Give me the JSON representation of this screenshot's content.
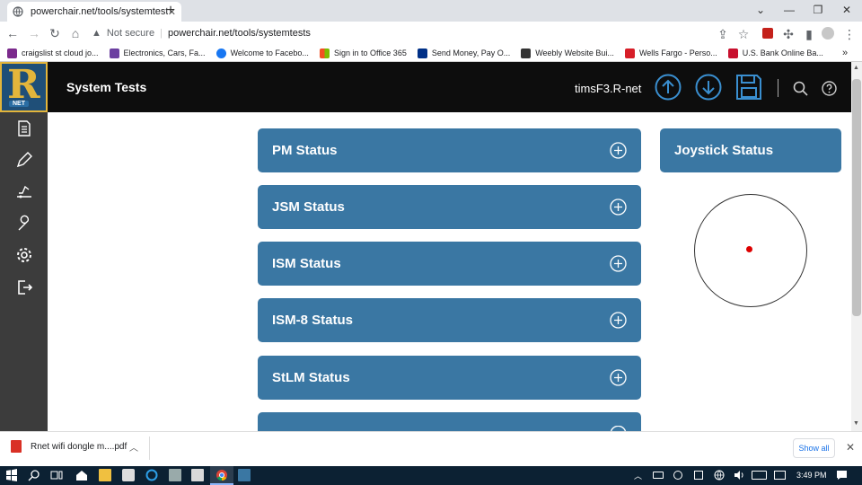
{
  "browser": {
    "tab_title": "powerchair.net/tools/systemtests",
    "new_tab": "+",
    "security": "Not secure",
    "url": "powerchair.net/tools/systemtests",
    "bookmarks": [
      {
        "label": "craigslist st cloud jo...",
        "color": "#7b2a8c"
      },
      {
        "label": "Electronics, Cars, Fa...",
        "color": "#6b3fa0"
      },
      {
        "label": "Welcome to Facebo...",
        "color": "#1877f2"
      },
      {
        "label": "Sign in to Office 365",
        "color": "#f25022"
      },
      {
        "label": "Send Money, Pay O...",
        "color": "#003087"
      },
      {
        "label": "Weebly Website Bui...",
        "color": "#333333"
      },
      {
        "label": "Wells Fargo - Perso...",
        "color": "#d71e28"
      },
      {
        "label": "U.S. Bank Online Ba...",
        "color": "#c8102e"
      }
    ],
    "bookmarks_more": "»"
  },
  "app": {
    "title": "System Tests",
    "device": "timsF3.R-net",
    "logo_letter": "R",
    "logo_sub": "NET",
    "header_color": "#0d0d0d",
    "accent": "#3a77a3"
  },
  "panels": [
    {
      "label": "PM Status"
    },
    {
      "label": "JSM Status"
    },
    {
      "label": "ISM Status"
    },
    {
      "label": "ISM-8 Status"
    },
    {
      "label": "StLM Status"
    },
    {
      "label": ""
    }
  ],
  "joystick": {
    "label": "Joystick Status"
  },
  "download": {
    "file": "Rnet wifi dongle m....pdf",
    "show_all": "Show all"
  },
  "taskbar": {
    "time": "3:49 PM"
  }
}
